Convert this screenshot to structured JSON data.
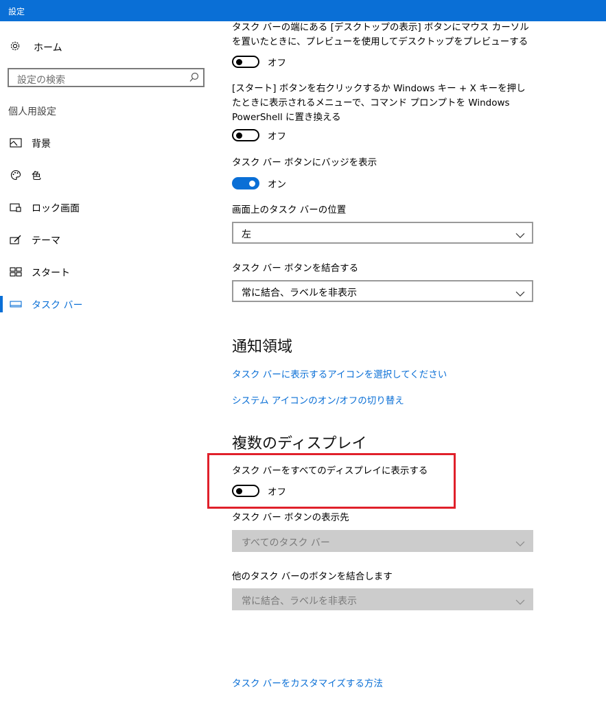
{
  "window": {
    "title": "設定"
  },
  "sidebar": {
    "home_label": "ホーム",
    "search_placeholder": "設定の検索",
    "section_label": "個人用設定",
    "items": [
      {
        "label": "背景",
        "icon": "picture-icon"
      },
      {
        "label": "色",
        "icon": "palette-icon"
      },
      {
        "label": "ロック画面",
        "icon": "lock-screen-icon"
      },
      {
        "label": "テーマ",
        "icon": "theme-icon"
      },
      {
        "label": "スタート",
        "icon": "start-icon"
      },
      {
        "label": "タスク バー",
        "icon": "taskbar-icon",
        "active": true
      }
    ]
  },
  "main": {
    "peek": {
      "desc": "タスク バーの端にある [デスクトップの表示] ボタンにマウス カーソルを置いたときに、プレビューを使用してデスクトップをプレビューする",
      "state": "オフ"
    },
    "powershell": {
      "desc": "[スタート] ボタンを右クリックするか Windows キー + X キーを押したときに表示されるメニューで、コマンド プロンプトを Windows PowerShell に置き換える",
      "state": "オフ"
    },
    "badges": {
      "desc": "タスク バー ボタンにバッジを表示",
      "state": "オン"
    },
    "position": {
      "label": "画面上のタスク バーの位置",
      "value": "左"
    },
    "combine": {
      "label": "タスク バー ボタンを結合する",
      "value": "常に結合、ラベルを非表示"
    },
    "notification_area": {
      "heading": "通知領域",
      "link1": "タスク バーに表示するアイコンを選択してください",
      "link2": "システム アイコンのオン/オフの切り替え"
    },
    "multiple_displays": {
      "heading": "複数のディスプレイ",
      "show_all": {
        "desc": "タスク バーをすべてのディスプレイに表示する",
        "state": "オフ"
      },
      "buttons_on": {
        "label": "タスク バー ボタンの表示先",
        "value": "すべてのタスク バー"
      },
      "other_combine": {
        "label": "他のタスク バーのボタンを結合します",
        "value": "常に結合、ラベルを非表示"
      }
    },
    "help_link": "タスク バーをカスタマイズする方法"
  },
  "colors": {
    "accent": "#0a6fd6",
    "highlight": "#e0202a",
    "disabled_bg": "#cccccc"
  }
}
